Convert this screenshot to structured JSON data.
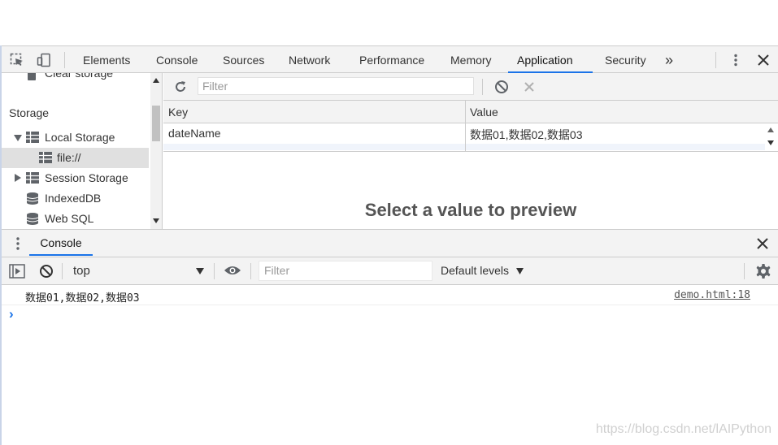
{
  "toolbar": {
    "tabs": [
      "Elements",
      "Console",
      "Sources",
      "Network",
      "Performance",
      "Memory",
      "Application",
      "Security"
    ],
    "active_tab": "Application",
    "overflow_label": "»",
    "accent": "#1a73e8"
  },
  "sidebar": {
    "partial_item": "Clear storage",
    "section_title": "Storage",
    "items": [
      {
        "label": "Local Storage",
        "icon": "grid-icon",
        "expanded": true
      },
      {
        "label": "file://",
        "icon": "grid-icon",
        "selected": true
      },
      {
        "label": "Session Storage",
        "icon": "grid-icon",
        "expanded": false
      },
      {
        "label": "IndexedDB",
        "icon": "database-icon"
      },
      {
        "label": "Web SQL",
        "icon": "database-icon"
      }
    ]
  },
  "storage": {
    "filter_placeholder": "Filter",
    "columns": [
      "Key",
      "Value"
    ],
    "rows": [
      {
        "key": "dateName",
        "value": "数据01,数据02,数据03"
      }
    ],
    "preview": "Select a value to preview"
  },
  "drawer": {
    "tab": "Console",
    "context": "top",
    "filter_placeholder": "Filter",
    "levels": "Default levels",
    "messages": [
      {
        "text": "数据01,数据02,数据03",
        "source": "demo.html:18"
      }
    ],
    "prompt": "›"
  },
  "watermark": "https://blog.csdn.net/lAIPython"
}
